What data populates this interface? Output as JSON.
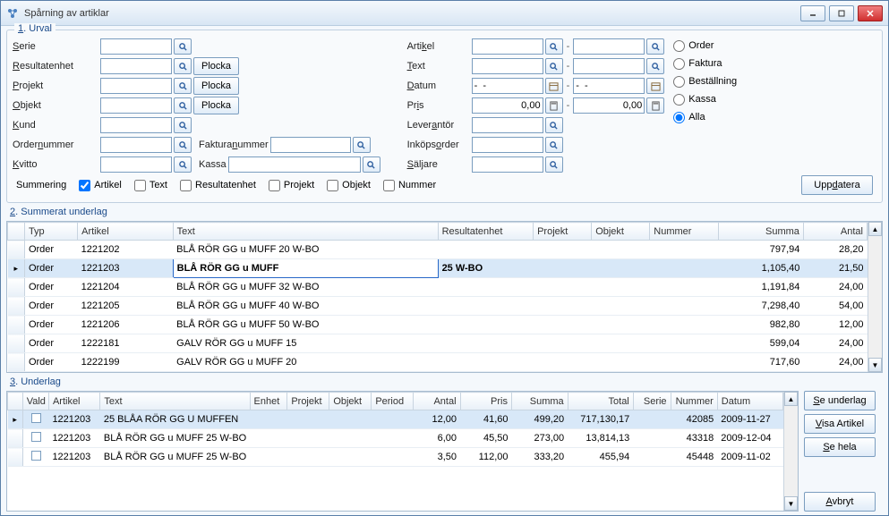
{
  "window": {
    "title": "Spårning av artiklar"
  },
  "urval": {
    "legend": "1. Urval",
    "labels": {
      "serie": "Serie",
      "resultatenhet": "Resultatenhet",
      "projekt": "Projekt",
      "objekt": "Objekt",
      "kund": "Kund",
      "ordernummer": "Ordernummer",
      "kvitto": "Kvitto",
      "artikel": "Artikel",
      "text": "Text",
      "datum": "Datum",
      "pris": "Pris",
      "leverantor": "Leverantör",
      "fakturanummer": "Fakturanummer",
      "inkopsorder": "Inköpsorder",
      "kassa": "Kassa",
      "saljare": "Säljare"
    },
    "values": {
      "serie": "",
      "resultatenhet": "",
      "projekt": "",
      "objekt": "",
      "kund": "",
      "ordernummer": "",
      "kvitto": "",
      "artikel_from": "",
      "artikel_to": "",
      "text_from": "",
      "text_to": "",
      "datum_from": "-  -",
      "datum_to": "-  -",
      "pris_from": "0,00",
      "pris_to": "0,00",
      "leverantor": "",
      "fakturanummer": "",
      "inkopsorder": "",
      "kassa": "",
      "saljare": ""
    },
    "buttons": {
      "plocka": "Plocka",
      "uppdatera": "Uppdatera"
    },
    "radios": {
      "order": "Order",
      "faktura": "Faktura",
      "bestallning": "Beställning",
      "kassa": "Kassa",
      "alla": "Alla"
    },
    "radio_selected": "alla"
  },
  "summering": {
    "label": "Summering",
    "items": {
      "artikel": "Artikel",
      "text": "Text",
      "resultatenhet": "Resultatenhet",
      "projekt": "Projekt",
      "objekt": "Objekt",
      "nummer": "Nummer"
    },
    "checked": [
      "artikel"
    ]
  },
  "grid2": {
    "legend": "2. Summerat underlag",
    "headers": {
      "typ": "Typ",
      "artikel": "Artikel",
      "text": "Text",
      "resultatenhet": "Resultatenhet",
      "projekt": "Projekt",
      "objekt": "Objekt",
      "nummer": "Nummer",
      "summa": "Summa",
      "antal": "Antal"
    },
    "rows": [
      {
        "typ": "Order",
        "artikel": "1221202",
        "text": "BLÅ RÖR GG u MUFF  20 W-BO",
        "summa": "797,94",
        "antal": "28,20"
      },
      {
        "typ": "Order",
        "artikel": "1221203",
        "text_a": "BLÅ RÖR GG u MUFF",
        "text_b": "25 W-BO",
        "summa": "1,105,40",
        "antal": "21,50",
        "selected": true
      },
      {
        "typ": "Order",
        "artikel": "1221204",
        "text": "BLÅ RÖR GG u MUFF  32 W-BO",
        "summa": "1,191,84",
        "antal": "24,00"
      },
      {
        "typ": "Order",
        "artikel": "1221205",
        "text": "BLÅ RÖR GG u MUFF  40 W-BO",
        "summa": "7,298,40",
        "antal": "54,00"
      },
      {
        "typ": "Order",
        "artikel": "1221206",
        "text": "BLÅ RÖR GG u MUFF  50 W-BO",
        "summa": "982,80",
        "antal": "12,00"
      },
      {
        "typ": "Order",
        "artikel": "1222181",
        "text": "GALV RÖR GG u MUFF  15",
        "summa": "599,04",
        "antal": "24,00"
      },
      {
        "typ": "Order",
        "artikel": "1222199",
        "text": "GALV RÖR GG u MUFF  20",
        "summa": "717,60",
        "antal": "24,00"
      }
    ]
  },
  "grid3": {
    "legend": "3. Underlag",
    "headers": {
      "vald": "Vald",
      "artikel": "Artikel",
      "text": "Text",
      "enhet": "Enhet",
      "projekt": "Projekt",
      "objekt": "Objekt",
      "period": "Period",
      "antal": "Antal",
      "pris": "Pris",
      "summa": "Summa",
      "total": "Total",
      "serie": "Serie",
      "nummer": "Nummer",
      "datum": "Datum"
    },
    "rows": [
      {
        "artikel": "1221203",
        "text": "25   BLÅA RÖR GG U MUFFEN",
        "antal": "12,00",
        "pris": "41,60",
        "summa": "499,20",
        "total": "717,130,17",
        "serie": "",
        "nummer": "42085",
        "datum": "2009-11-27",
        "selected": true
      },
      {
        "artikel": "1221203",
        "text": "BLÅ RÖR GG u MUFF  25 W-BO",
        "antal": "6,00",
        "pris": "45,50",
        "summa": "273,00",
        "total": "13,814,13",
        "serie": "",
        "nummer": "43318",
        "datum": "2009-12-04"
      },
      {
        "artikel": "1221203",
        "text": "BLÅ RÖR GG u MUFF  25 W-BO",
        "antal": "3,50",
        "pris": "112,00",
        "summa": "333,20",
        "total": "455,94",
        "serie": "",
        "nummer": "45448",
        "datum": "2009-11-02"
      }
    ]
  },
  "buttons": {
    "se_underlag": "Se underlag",
    "visa_artikel": "Visa Artikel",
    "se_hela": "Se hela",
    "avbryt": "Avbryt"
  }
}
